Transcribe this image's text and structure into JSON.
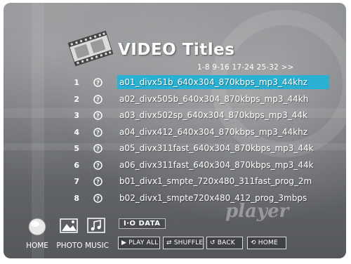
{
  "header": {
    "title": "VIDEO Titles",
    "icon": "film-reel-icon"
  },
  "pager": {
    "text": "1-8 9-16 17-24 25-32 >>"
  },
  "list": {
    "selected_index": 0,
    "items": [
      {
        "number": "1",
        "name": "a01_divx51b_640x304_870kbps_mp3_44khz"
      },
      {
        "number": "2",
        "name": "a02_divx505b_640x304_870kbps_mp3_44kh"
      },
      {
        "number": "3",
        "name": "a03_divx502sp_640x304_870kbps_mp3_44k"
      },
      {
        "number": "4",
        "name": "a04_divx412_640x304_870kbps_mp3_44khz"
      },
      {
        "number": "5",
        "name": "a05_divx311fast_640x304_870kbps_mp3_44k"
      },
      {
        "number": "6",
        "name": "a06_divx311fast_640x304_870kbps_mp3_44k"
      },
      {
        "number": "7",
        "name": "b01_divx1_smpte_720x480_311fast_prog_2m"
      },
      {
        "number": "8",
        "name": "b02_divx1_smpte720x480_412_prog_3mbps"
      }
    ]
  },
  "nav": {
    "home": {
      "label": "HOME",
      "icon": "home-icon"
    },
    "photo": {
      "label": "PHOTO",
      "icon": "photo-icon"
    },
    "music": {
      "label": "MUSIC",
      "icon": "music-icon"
    }
  },
  "brand": {
    "text": "I·O DATA"
  },
  "watermark": {
    "text": "player"
  },
  "buttons": {
    "play_all": "PLAY ALL",
    "shuffle": "SHUFFLE",
    "back": "BACK",
    "home": "HOME"
  },
  "colors": {
    "selection": "#2ab0d2",
    "text": "#ffffff",
    "background": "#6d7073"
  }
}
